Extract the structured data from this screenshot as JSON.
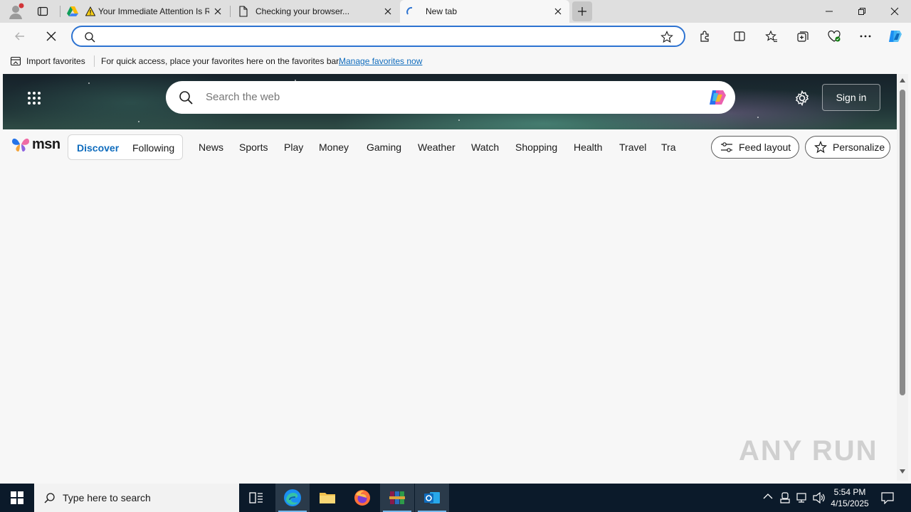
{
  "tabs": [
    {
      "title": "Your Immediate Attention Is Required",
      "active": false
    },
    {
      "title": "Checking your browser...",
      "active": false
    },
    {
      "title": "New tab",
      "active": true
    }
  ],
  "address": {
    "value": ""
  },
  "favorites_bar": {
    "import_label": "Import favorites",
    "message": "For quick access, place your favorites here on the favorites bar.",
    "link": "Manage favorites now"
  },
  "msn": {
    "search_placeholder": "Search the web",
    "sign_in": "Sign in",
    "logo_text": "msn",
    "segment": {
      "discover": "Discover",
      "following": "Following"
    },
    "nav": [
      "News",
      "Sports",
      "Play",
      "Money",
      "Gaming",
      "Weather",
      "Watch",
      "Shopping",
      "Health",
      "Travel",
      "Trai"
    ],
    "feed_layout": "Feed layout",
    "personalize": "Personalize"
  },
  "watermark": "ANY RUN",
  "taskbar": {
    "search_placeholder": "Type here to search",
    "time": "5:54 PM",
    "date": "4/15/2025"
  },
  "colors": {
    "accent": "#2d73d1",
    "link": "#0f6cbd",
    "taskbar": "#0b1a2a"
  }
}
